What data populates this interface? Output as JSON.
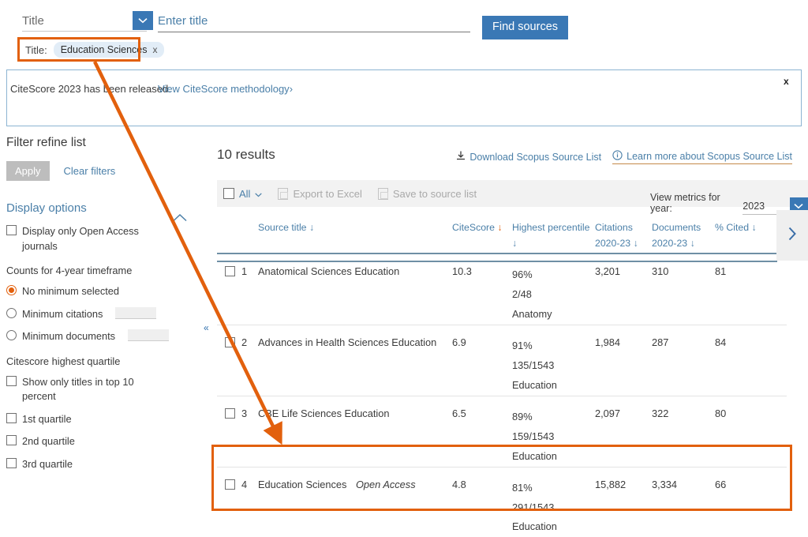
{
  "search": {
    "field_label": "Title",
    "field_caret_icon": "chevron-down-icon",
    "input_placeholder": "Enter title",
    "input_value": "",
    "find_button": "Find sources"
  },
  "applied_filters": {
    "prefix": "Title:",
    "chip_label": "Education Sciences",
    "chip_remove_icon": "x"
  },
  "banner": {
    "text": "CiteScore 2023 has been released.",
    "link": "View CiteScore methodology",
    "link_chevron": "›",
    "close_label": "x"
  },
  "sidebar": {
    "title": "Filter refine list",
    "apply_label": "Apply",
    "clear_label": "Clear filters",
    "display_options_label": "Display options",
    "open_access_label": "Display only Open Access journals",
    "counts_label": "Counts for 4-year timeframe",
    "radio_no_minimum": "No minimum selected",
    "radio_min_citations": "Minimum citations",
    "radio_min_documents": "Minimum documents",
    "quartile_label": "Citescore highest quartile",
    "top10_label": "Show only titles in top 10 percent",
    "q1_label": "1st quartile",
    "q2_label": "2nd quartile",
    "q3_label": "3rd quartile",
    "collapse_chevron_icon": "chevron-up-icon",
    "collapse_double_icon": "«"
  },
  "results": {
    "count_label": "10 results",
    "download_link": "Download Scopus Source List",
    "learn_more_link": "Learn more about Scopus Source List",
    "toolbar": {
      "select_all": "All",
      "select_all_caret": "∨",
      "export_excel": "Export to Excel",
      "save_list": "Save to source list"
    },
    "metrics_year": {
      "label": "View metrics for year:",
      "value": "2023",
      "caret_icon": "chevron-down-icon"
    },
    "columns": {
      "source_title": "Source title",
      "citescore": "CiteScore",
      "highest_percentile": "Highest percentile",
      "citations": "Citations 2020-23",
      "documents": "Documents 2020-23",
      "pct_cited": "% Cited",
      "sort_arrow": "↓"
    },
    "rows": [
      {
        "num": "1",
        "title": "Anatomical Sciences Education",
        "open_access": "",
        "citescore": "10.3",
        "percentile": "96%",
        "rank": "2/48",
        "subject": "Anatomy",
        "citations": "3,201",
        "documents": "310",
        "pct_cited": "81"
      },
      {
        "num": "2",
        "title": "Advances in Health Sciences Education",
        "open_access": "",
        "citescore": "6.9",
        "percentile": "91%",
        "rank": "135/1543",
        "subject": "Education",
        "citations": "1,984",
        "documents": "287",
        "pct_cited": "84"
      },
      {
        "num": "3",
        "title": "CBE Life Sciences Education",
        "open_access": "",
        "citescore": "6.5",
        "percentile": "89%",
        "rank": "159/1543",
        "subject": "Education",
        "citations": "2,097",
        "documents": "322",
        "pct_cited": "80"
      },
      {
        "num": "4",
        "title": "Education Sciences",
        "open_access": "Open Access",
        "citescore": "4.8",
        "percentile": "81%",
        "rank": "291/1543",
        "subject": "Education",
        "citations": "15,882",
        "documents": "3,334",
        "pct_cited": "66"
      }
    ],
    "scroll_right_icon": "chevron-right-icon"
  },
  "annotation": {
    "color": "#e2600d",
    "arrow_from": "title filter chip",
    "arrow_to": "Education Sciences result row"
  }
}
